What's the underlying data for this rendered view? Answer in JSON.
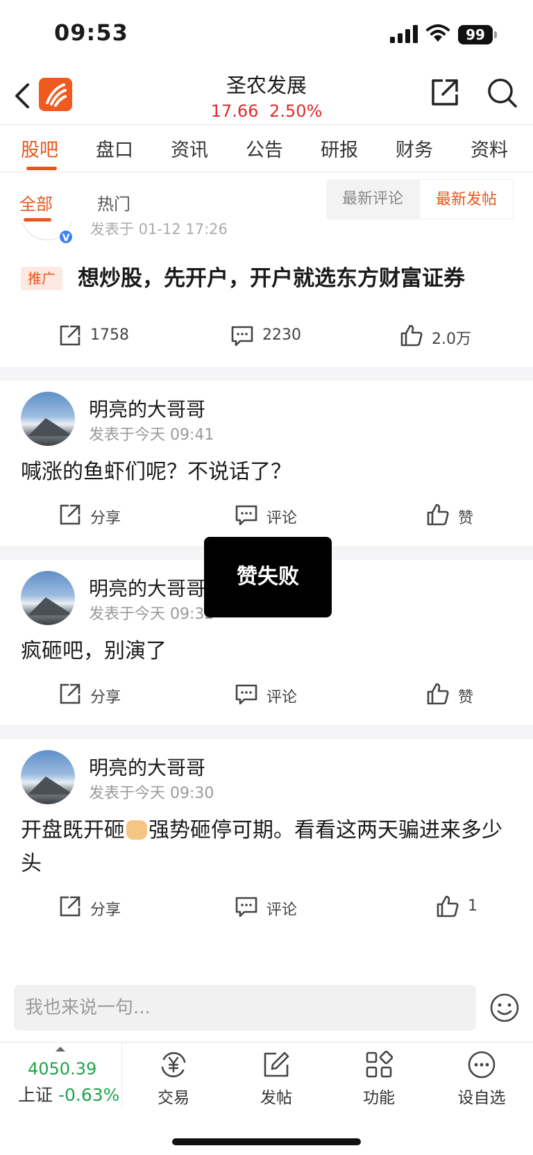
{
  "status_bar": {
    "time": "09:53",
    "battery": "99"
  },
  "header": {
    "title": "圣农发展",
    "price": "17.66",
    "change_pct": "2.50%"
  },
  "tabs": [
    {
      "label": "股吧",
      "active": true
    },
    {
      "label": "盘口"
    },
    {
      "label": "资讯"
    },
    {
      "label": "公告"
    },
    {
      "label": "研报"
    },
    {
      "label": "财务"
    },
    {
      "label": "资料"
    }
  ],
  "subtabs": [
    {
      "label": "全部",
      "active": true
    },
    {
      "label": "热门"
    }
  ],
  "sort": [
    {
      "label": "最新评论"
    },
    {
      "label": "最新发帖",
      "active": true
    }
  ],
  "promo_post": {
    "meta": "发表于 01-12 17:26",
    "verified_mark": "V",
    "tag": "推广",
    "text": "想炒股，先开户，开户就选东方财富证券",
    "shares": "1758",
    "comments": "2230",
    "likes": "2.0万"
  },
  "posts": [
    {
      "user": "明亮的大哥哥",
      "time": "发表于今天 09:41",
      "body": "喊涨的鱼虾们呢？不说话了？",
      "share": "分享",
      "comment": "评论",
      "like": "赞"
    },
    {
      "user": "明亮的大哥哥",
      "time": "发表于今天 09:32",
      "body": "疯砸吧，别演了",
      "share": "分享",
      "comment": "评论",
      "like": "赞"
    },
    {
      "user": "明亮的大哥哥",
      "time": "发表于今天 09:30",
      "body_before": "开盘既开砸",
      "body_emoji": "thumbs-up",
      "body_after": "强势砸停可期。看看这两天骗进来多少头",
      "share": "分享",
      "comment": "评论",
      "like": "1"
    }
  ],
  "toast": "赞失败",
  "comment_placeholder": "我也来说一句...",
  "index": {
    "value": "4050.39",
    "name": "上证",
    "change": "-0.63%"
  },
  "bottom_nav": [
    {
      "label": "交易",
      "icon": "trade-icon"
    },
    {
      "label": "发帖",
      "icon": "compose-icon"
    },
    {
      "label": "功能",
      "icon": "functions-icon"
    },
    {
      "label": "设自选",
      "icon": "more-icon"
    }
  ],
  "colors": {
    "accent": "#e8561c",
    "up": "#e02a2a",
    "down": "#1ea34a",
    "toast_bg": "#000000"
  }
}
